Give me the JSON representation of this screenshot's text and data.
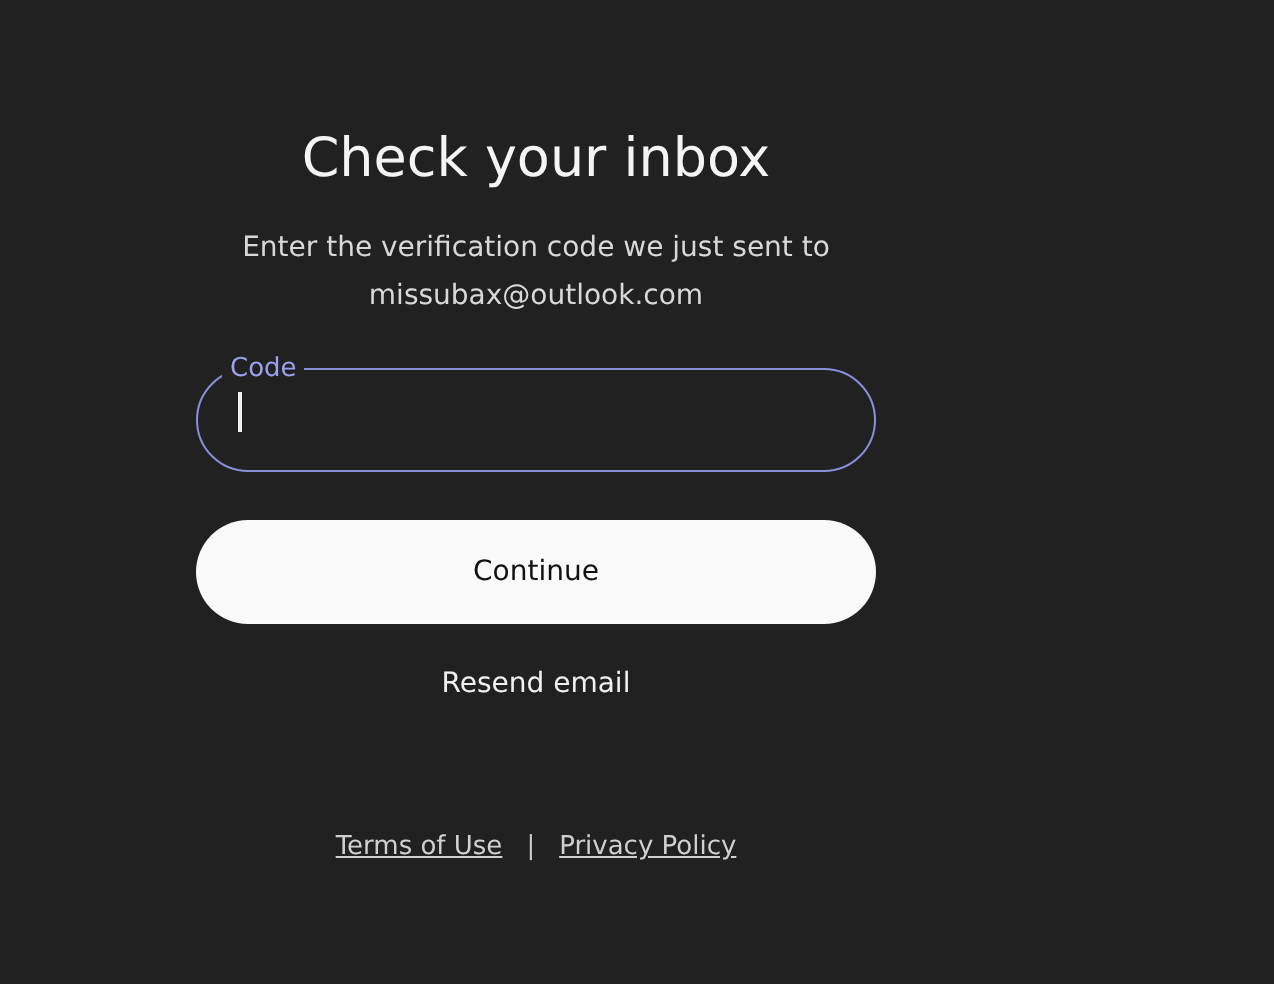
{
  "title": "Check your inbox",
  "subtitle": "Enter the verification code we just sent to missubax@outlook.com",
  "code_field": {
    "label": "Code",
    "focused": true
  },
  "continue_button": "Continue",
  "resend_link": "Resend email",
  "footer": {
    "links": [
      "Terms of Use",
      "Privacy Policy"
    ],
    "separator": "|"
  }
}
